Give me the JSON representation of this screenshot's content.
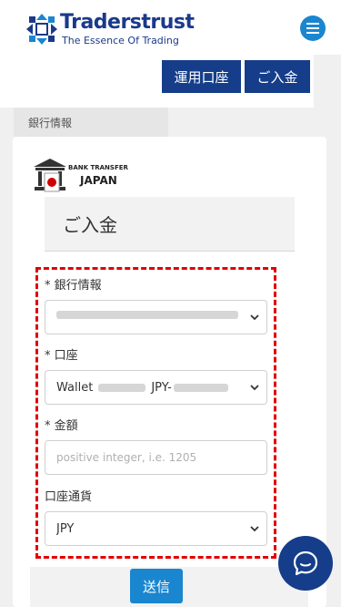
{
  "brand": {
    "name": "Traderstrust",
    "tagline": "The Essence Of Trading"
  },
  "nav": {
    "account_label": "運用口座",
    "deposit_label": "ご入金"
  },
  "tab": {
    "label": "銀行情報"
  },
  "bank_logo": {
    "line1": "BANK TRANSFER",
    "line2": "JAPAN"
  },
  "page": {
    "title": "ご入金"
  },
  "form": {
    "bank_label": "* 銀行情報",
    "account_label": "* 口座",
    "account_prefix": "Wallet",
    "account_mid": "JPY-",
    "amount_label": "* 金額",
    "amount_placeholder": "positive integer, i.e. 1205",
    "currency_label": "口座通貨",
    "currency_value": "JPY",
    "submit_label": "送信"
  },
  "colors": {
    "brand_blue": "#153d8a",
    "accent_blue": "#1a86d0",
    "highlight_red": "#e00000"
  }
}
